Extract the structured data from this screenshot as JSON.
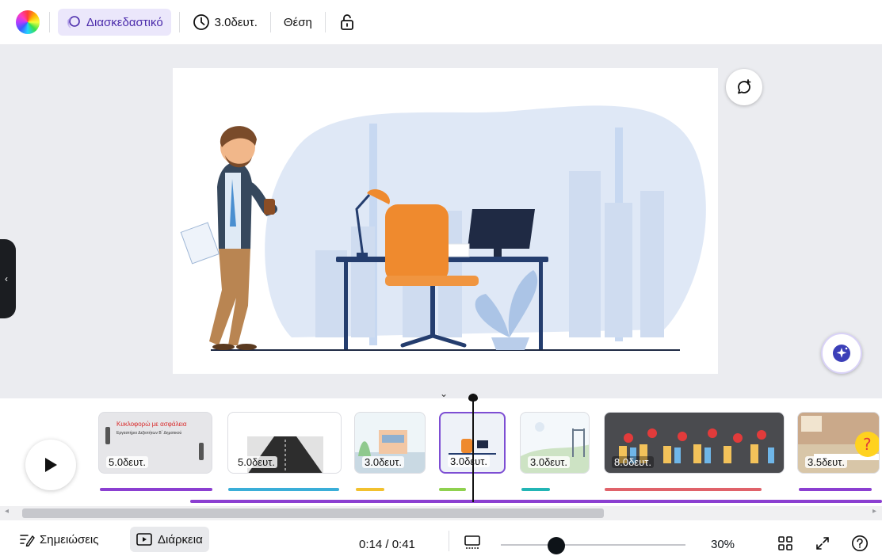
{
  "toolbar": {
    "animation_label": "Διασκεδαστικό",
    "duration_label": "3.0δευτ.",
    "position_label": "Θέση"
  },
  "timeline": {
    "clips": [
      {
        "duration": "5.0δευτ.",
        "title": "Κυκλοφορώ με ασφάλεια",
        "subtitle": "Εργαστήριο Δεξιοτήτων Β΄ Δημοτικού",
        "bar_color": "#8b3fd1"
      },
      {
        "duration": "5.0δευτ.",
        "bar_color": "#3aaed8"
      },
      {
        "duration": "3.0δευτ.",
        "bar_color": "#f2c12e"
      },
      {
        "duration": "3.0δευτ.",
        "bar_color": "#8fd14f"
      },
      {
        "duration": "3.0δευτ.",
        "bar_color": "#22b5b5"
      },
      {
        "duration": "8.0δευτ.",
        "bar_color": "#e0626a"
      },
      {
        "duration": "3.5δευτ.",
        "bar_color": "#8b3fd1"
      }
    ],
    "audio_track_color": "#8b3fd1"
  },
  "bottom": {
    "notes_label": "Σημειώσεις",
    "duration_label": "Διάρκεια",
    "time_readout": "0:14 / 0:41",
    "zoom_label": "30%",
    "zoom_fraction": 0.3
  },
  "colors": {
    "accent": "#7d4ed3",
    "active_bg": "#ebe7fb"
  },
  "icons": [
    "color-wheel-icon",
    "animation-icon",
    "clock-icon",
    "lock-icon",
    "comment-add-icon",
    "magic-sparkle-icon",
    "play-icon",
    "notes-icon",
    "duration-icon",
    "grid-view-icon",
    "fullscreen-icon",
    "help-icon",
    "chevron-left-icon",
    "chevron-down-icon"
  ]
}
